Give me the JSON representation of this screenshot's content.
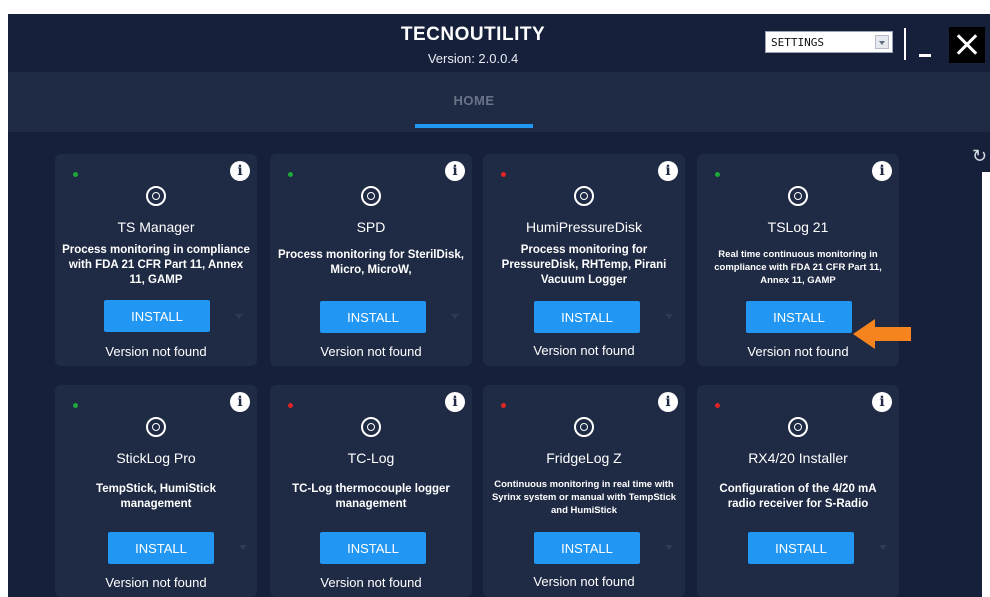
{
  "app": {
    "title": "TECNOUTILITY",
    "version": "Version: 2.0.0.4",
    "settings_value": "SETTINGS",
    "accent_color": "#2196f3",
    "background_color": "#16203a"
  },
  "tabs": [
    {
      "label": "HOME",
      "active": true
    }
  ],
  "cards": [
    {
      "name": "TS Manager",
      "description": "Process monitoring in compliance with FDA 21 CFR Part 11, Annex 11, GAMP",
      "status": "green",
      "button": "INSTALL",
      "version_text": "Version not found"
    },
    {
      "name": "SPD",
      "description": "Process monitoring for SterilDisk, Micro, MicroW,",
      "status": "green",
      "button": "INSTALL",
      "version_text": "Version not found"
    },
    {
      "name": "HumiPressureDisk",
      "description": "Process monitoring for PressureDisk, RHTemp, Pirani Vacuum Logger",
      "status": "red",
      "button": "INSTALL",
      "version_text": "Version not found"
    },
    {
      "name": "TSLog 21",
      "description": "Real time continuous monitoring in compliance with FDA 21 CFR Part 11, Annex 11, GAMP",
      "status": "green",
      "button": "INSTALL",
      "version_text": "Version not found"
    },
    {
      "name": "StickLog Pro",
      "description": "TempStick, HumiStick management",
      "status": "green",
      "button": "INSTALL",
      "version_text": "Version not found"
    },
    {
      "name": "TC-Log",
      "description": "TC-Log thermocouple logger management",
      "status": "red",
      "button": "INSTALL",
      "version_text": "Version not found"
    },
    {
      "name": "FridgeLog Z",
      "description": "Continuous monitoring in real time with Syrinx system or manual with TempStick and HumiStick",
      "status": "red",
      "button": "INSTALL",
      "version_text": "Version not found"
    },
    {
      "name": "RX4/20 Installer",
      "description": "Configuration of the 4/20 mA radio receiver for S-Radio",
      "status": "red",
      "button": "INSTALL",
      "version_text": ""
    }
  ],
  "icons": {
    "info": "i",
    "refresh": "↻",
    "app": "radio-signal-icon",
    "arrow": "orange-arrow-icon"
  },
  "status_colors": {
    "green": "#1fa83a",
    "red": "#e02525"
  },
  "arrow_color": "#f5841f"
}
